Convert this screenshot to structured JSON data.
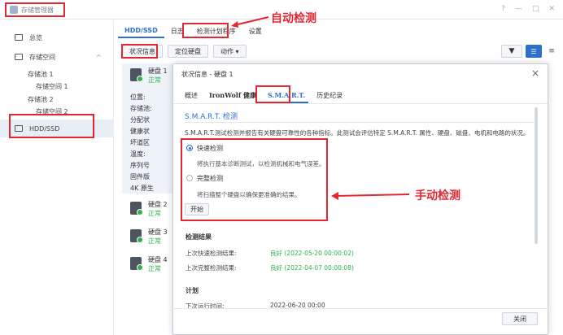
{
  "app": {
    "title": "存储管理器",
    "window_controls": [
      "?",
      "—",
      "□",
      "✕"
    ]
  },
  "sidebar": {
    "overview": "总览",
    "storage_space": "存储空间",
    "pool1": "存储池 1",
    "volume1": "存储空间 1",
    "pool2": "存储池 2",
    "volume2": "存储空间 2",
    "hdd_ssd": "HDD/SSD"
  },
  "tabs": [
    "HDD/SSD",
    "日志",
    "检测计划程序",
    "设置"
  ],
  "toolbar": {
    "status": "状况信息",
    "locate": "定位硬盘",
    "action": "动作 ▾"
  },
  "disks": [
    {
      "name": "硬盘 1",
      "status": "正常"
    },
    {
      "name": "硬盘 2",
      "status": "正常"
    },
    {
      "name": "硬盘 3",
      "status": "正常"
    },
    {
      "name": "硬盘 4",
      "status": "正常"
    }
  ],
  "disk_detail_labels": [
    "位置:",
    "存储池:",
    "分配状",
    "健康状",
    "坏道区",
    "温度:",
    "序列号",
    "固件版",
    "4K 原生"
  ],
  "dialog": {
    "title": "状况信息 - 硬盘 1",
    "tabs": [
      "概述",
      "IronWolf 健康",
      "S.M.A.R.T.",
      "历史纪录"
    ],
    "section_title": "S.M.A.R.T. 检测",
    "description": "S.M.A.R.T.测试检测并报告有关硬盘可靠性的各种指标。此测试会评估特定 S.M.A.R.T. 属性、硬盘、磁盘、电机和电路的状况。",
    "quick_label": "快速检测",
    "quick_desc": "将执行基本诊断测试，以检测机械和电气误差。",
    "full_label": "完整检测",
    "full_desc": "将扫描整个硬盘以确保更准确的结果。",
    "start": "开始",
    "results_title": "检测结果",
    "last_quick_label": "上次快速检测结果:",
    "last_quick_value": "良好 (2022-05-20 00:00:02)",
    "last_full_label": "上次完整检测结果:",
    "last_full_value": "良好 (2022-04-07 00:00:08)",
    "schedule_title": "计划",
    "next_run_label": "下次运行时间:",
    "next_run_value": "2022-06-20 00:00",
    "close": "关闭"
  },
  "annotations": {
    "auto": "自动检测",
    "manual": "手动检测"
  },
  "colors": {
    "accent": "#2c6fcc",
    "highlight": "#e3262f",
    "ok": "#2db34a"
  }
}
